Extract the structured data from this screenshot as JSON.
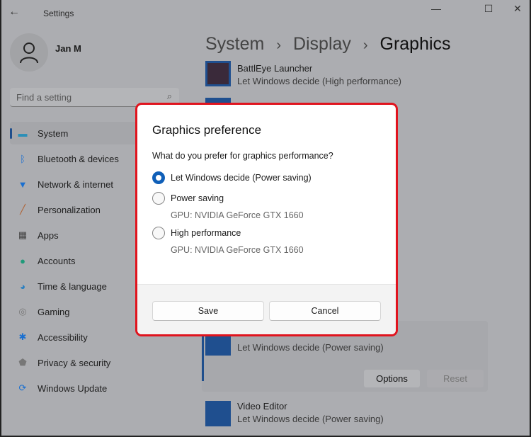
{
  "window": {
    "title": "Settings",
    "minimize": "—",
    "maximize": "☐",
    "close": "✕"
  },
  "user": {
    "name": "Jan M"
  },
  "search": {
    "placeholder": "Find a setting"
  },
  "sidebar": {
    "items": [
      {
        "label": "System",
        "icon": "monitor-icon",
        "glyph": "▬",
        "color": "#2a8fb8",
        "active": true
      },
      {
        "label": "Bluetooth & devices",
        "icon": "bluetooth-icon",
        "glyph": "ᛒ",
        "color": "#1a6fd0"
      },
      {
        "label": "Network & internet",
        "icon": "wifi-icon",
        "glyph": "▼",
        "color": "#1a6fd0"
      },
      {
        "label": "Personalization",
        "icon": "brush-icon",
        "glyph": "╱",
        "color": "#b06030"
      },
      {
        "label": "Apps",
        "icon": "apps-icon",
        "glyph": "▦",
        "color": "#444"
      },
      {
        "label": "Accounts",
        "icon": "person-icon",
        "glyph": "●",
        "color": "#1f9a7a"
      },
      {
        "label": "Time & language",
        "icon": "clock-globe-icon",
        "glyph": "◕",
        "color": "#2a7fc0"
      },
      {
        "label": "Gaming",
        "icon": "gamepad-icon",
        "glyph": "◎",
        "color": "#777"
      },
      {
        "label": "Accessibility",
        "icon": "accessibility-icon",
        "glyph": "✱",
        "color": "#1a6fd0"
      },
      {
        "label": "Privacy & security",
        "icon": "shield-icon",
        "glyph": "⬟",
        "color": "#777"
      },
      {
        "label": "Windows Update",
        "icon": "update-icon",
        "glyph": "⟳",
        "color": "#1a6fd0"
      }
    ]
  },
  "breadcrumb": [
    "System",
    "Display",
    "Graphics"
  ],
  "apps": [
    {
      "name": "BattlEye Launcher",
      "pref": "Let Windows decide (High performance)"
    },
    {
      "name": "",
      "pref": "Let Windows decide (Power saving)"
    },
    {
      "name": "Video Editor",
      "pref": "Let Windows decide (Power saving)"
    }
  ],
  "app_actions": {
    "options": "Options",
    "reset": "Reset"
  },
  "dialog": {
    "title": "Graphics preference",
    "question": "What do you prefer for graphics performance?",
    "options": [
      {
        "label": "Let Windows decide (Power saving)",
        "selected": true
      },
      {
        "label": "Power saving",
        "gpu": "GPU: NVIDIA GeForce GTX 1660",
        "selected": false
      },
      {
        "label": "High performance",
        "gpu": "GPU: NVIDIA GeForce GTX 1660",
        "selected": false
      }
    ],
    "save": "Save",
    "cancel": "Cancel"
  },
  "colors": {
    "accent": "#0f5fb8",
    "highlight_border": "#e0141e"
  }
}
